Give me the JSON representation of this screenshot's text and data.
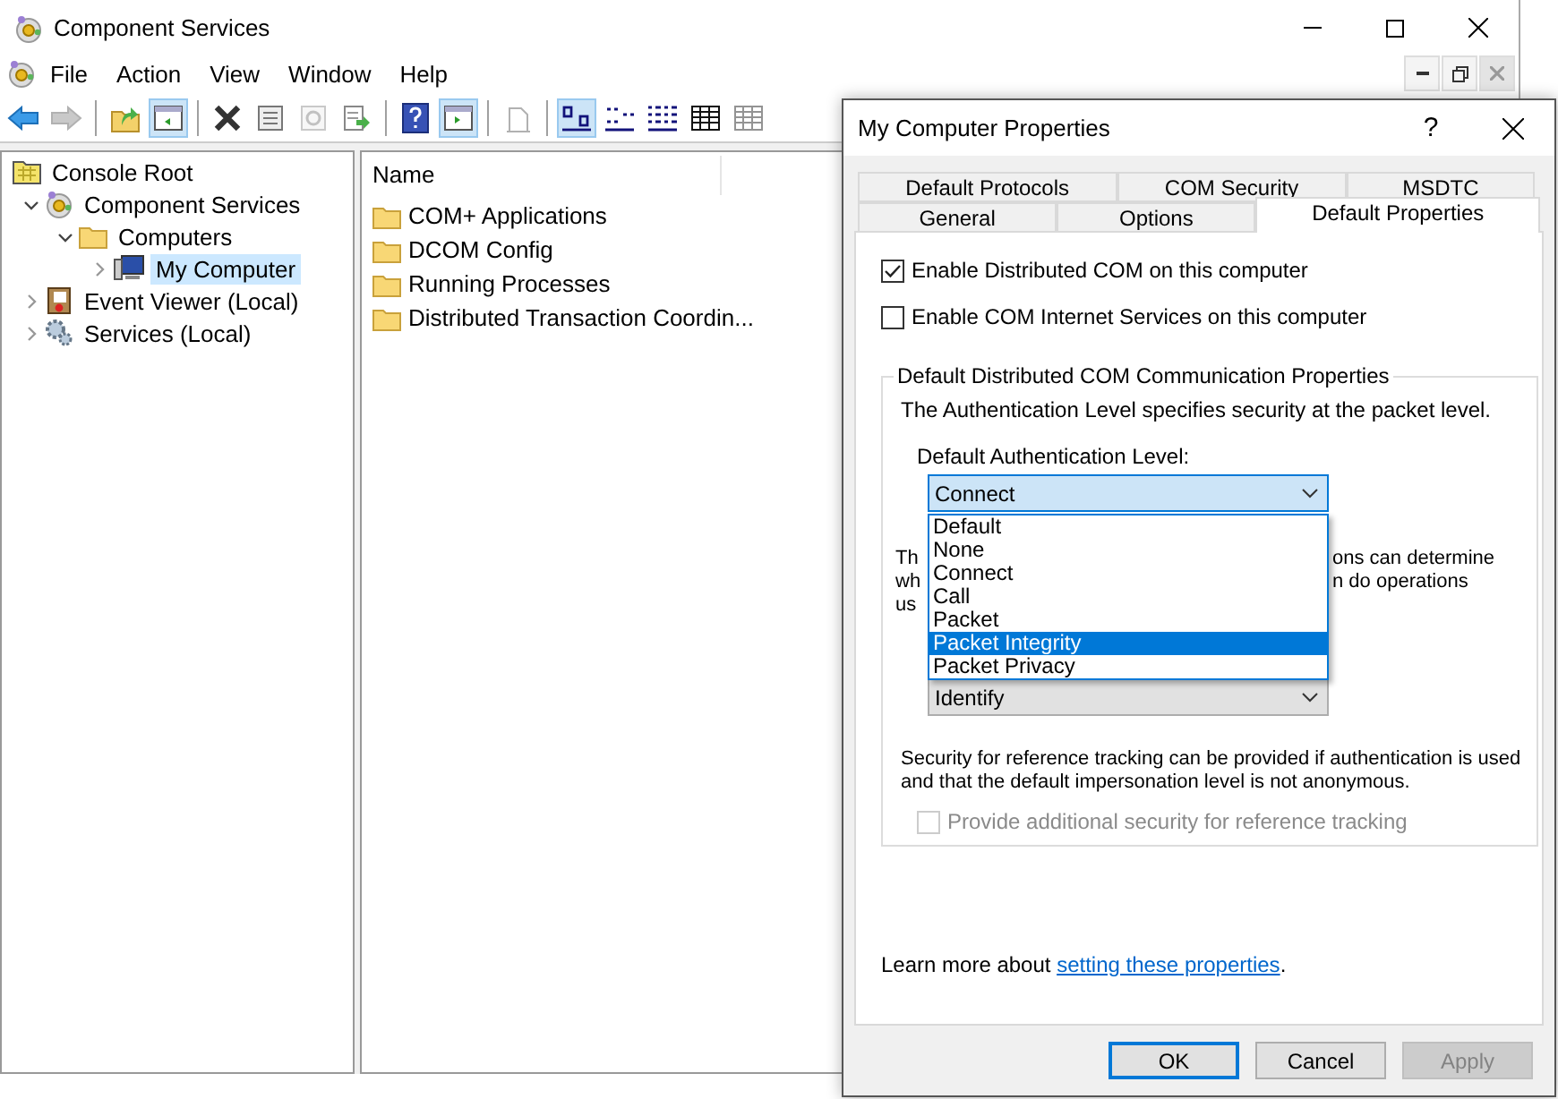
{
  "main_window": {
    "title": "Component Services",
    "menu": [
      "File",
      "Action",
      "View",
      "Window",
      "Help"
    ],
    "toolbar": [
      {
        "kind": "back",
        "pressed": false,
        "disabled": false
      },
      {
        "kind": "forward",
        "pressed": false,
        "disabled": true
      },
      {
        "kind": "separator"
      },
      {
        "kind": "up",
        "pressed": false,
        "disabled": false
      },
      {
        "kind": "tree",
        "pressed": true,
        "disabled": false
      },
      {
        "kind": "separator"
      },
      {
        "kind": "delete",
        "pressed": false,
        "disabled": false
      },
      {
        "kind": "properties",
        "pressed": false,
        "disabled": false
      },
      {
        "kind": "refresh",
        "pressed": false,
        "disabled": true
      },
      {
        "kind": "export",
        "pressed": false,
        "disabled": false
      },
      {
        "kind": "separator"
      },
      {
        "kind": "help",
        "pressed": false,
        "disabled": false
      },
      {
        "kind": "actionpane",
        "pressed": true,
        "disabled": false
      },
      {
        "kind": "separator"
      },
      {
        "kind": "newdoc",
        "pressed": false,
        "disabled": true
      },
      {
        "kind": "separator"
      },
      {
        "kind": "largeicons",
        "pressed": true,
        "disabled": false
      },
      {
        "kind": "smallicons",
        "pressed": false,
        "disabled": false
      },
      {
        "kind": "list",
        "pressed": false,
        "disabled": false
      },
      {
        "kind": "details",
        "pressed": false,
        "disabled": false
      },
      {
        "kind": "details",
        "pressed": false,
        "disabled": true
      }
    ],
    "tree": [
      {
        "label": "Console Root",
        "kind": "console",
        "selected": false,
        "children": [
          {
            "label": "Component Services",
            "kind": "component",
            "expanded": true,
            "selected": false,
            "children": [
              {
                "label": "Computers",
                "kind": "folder",
                "expanded": true,
                "selected": false,
                "children": [
                  {
                    "label": "My Computer",
                    "kind": "computer",
                    "expanded": false,
                    "selected": true
                  }
                ]
              }
            ]
          },
          {
            "label": "Event Viewer (Local)",
            "kind": "events",
            "expanded": false,
            "selected": false
          },
          {
            "label": "Services (Local)",
            "kind": "services",
            "expanded": false,
            "selected": false
          }
        ]
      }
    ],
    "list": {
      "columns": [
        "Name"
      ],
      "items": [
        "COM+ Applications",
        "DCOM Config",
        "Running Processes",
        "Distributed Transaction Coordin..."
      ]
    }
  },
  "dialog": {
    "title": "My Computer Properties",
    "help_button": "?",
    "tab_rows": [
      [
        {
          "label": "Default Protocols",
          "selected": false
        },
        {
          "label": "COM Security",
          "selected": false
        },
        {
          "label": "MSDTC",
          "selected": false
        }
      ],
      [
        {
          "label": "General",
          "selected": false
        },
        {
          "label": "Options",
          "selected": false
        },
        {
          "label": "Default Properties",
          "selected": true
        }
      ]
    ],
    "options": [
      {
        "label": "Enable Distributed COM on this computer",
        "checked": true,
        "disabled": false
      },
      {
        "label": "Enable COM Internet Services on this computer",
        "checked": false,
        "disabled": false
      }
    ],
    "group": {
      "legend": "Default Distributed COM Communication Properties",
      "description": "The Authentication Level specifies security at the packet level.",
      "auth_label": "Default Authentication Level:",
      "auth_value": "Connect",
      "auth_options": [
        {
          "label": "Default",
          "selected": false
        },
        {
          "label": "None",
          "selected": false
        },
        {
          "label": "Connect",
          "selected": false
        },
        {
          "label": "Call",
          "selected": false
        },
        {
          "label": "Packet",
          "selected": false
        },
        {
          "label": "Packet Integrity",
          "selected": true
        },
        {
          "label": "Packet Privacy",
          "selected": false
        }
      ],
      "covered_left": [
        "Th",
        "wh",
        "us"
      ],
      "covered_right": [
        "ons can determine",
        "n do operations"
      ],
      "impersonation_value": "Identify",
      "tracking_note": "Security for reference tracking can be provided if authentication is used and that the default impersonation level is not anonymous.",
      "tracking_option": {
        "label": "Provide additional security for reference tracking",
        "checked": false,
        "disabled": true
      }
    },
    "learn_more": {
      "text": "Learn more about ",
      "link": "setting these properties",
      "suffix": "."
    },
    "buttons": [
      {
        "label": "OK",
        "default": true,
        "disabled": false
      },
      {
        "label": "Cancel",
        "default": false,
        "disabled": false
      },
      {
        "label": "Apply",
        "default": false,
        "disabled": true
      }
    ]
  }
}
